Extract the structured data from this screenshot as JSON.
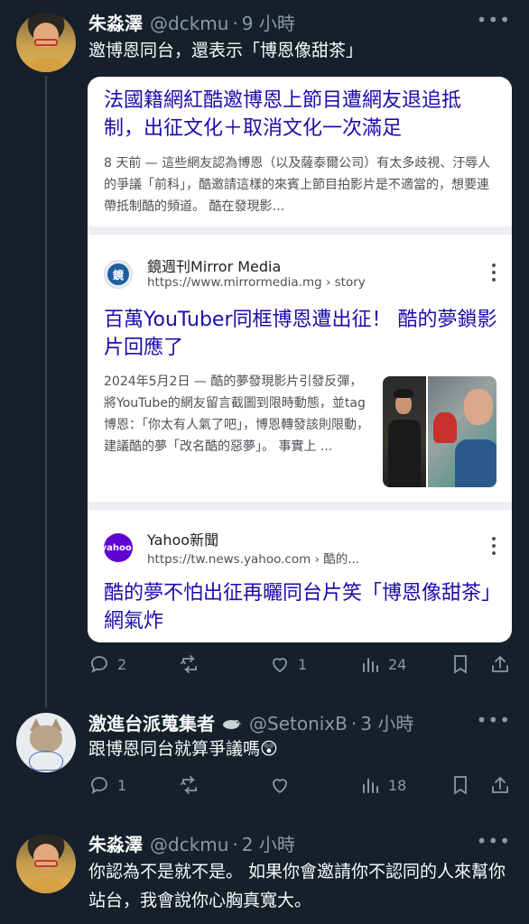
{
  "posts": [
    {
      "name": "朱淼澤",
      "handle": "@dckmu",
      "time": "9 小時",
      "text": "邀博恩同台，還表示「博恩像甜茶」",
      "actions": {
        "reply": "2",
        "retweet": "",
        "like": "1",
        "views": "24"
      }
    },
    {
      "name": "激進台派蒐集者",
      "handle": "@SetonixB",
      "time": "3 小時",
      "text": "跟博恩同台就算爭議嗎😲",
      "actions": {
        "reply": "1",
        "retweet": "",
        "like": "",
        "views": "18"
      }
    },
    {
      "name": "朱淼澤",
      "handle": "@dckmu",
      "time": "2 小時",
      "text": "你認為不是就不是。 如果你會邀請你不認同的人來幫你站台，我會說你心胸真寬大。"
    }
  ],
  "separator": "·",
  "more_label": "•••",
  "search_card": {
    "result1": {
      "title": "法國籍網紅酷邀博恩上節目遭網友退追抵制，出征文化＋取消文化一次滿足",
      "snippet": "8 天前 — 這些網友認為博恩（以及薩泰爾公司）有太多歧視、汙辱人的爭議「前科」，酷邀請這樣的來賓上節目拍影片是不適當的，想要連帶抵制酷的頻道。 酷在發現影…"
    },
    "result2": {
      "favicon": "鏡",
      "site": "鏡週刊Mirror Media",
      "url": "https://www.mirrormedia.mg › story",
      "title": "百萬YouTuber同框博恩遭出征！ 酷的夢鎖影片回應了",
      "snippet": "2024年5月2日 — 酷的夢發現影片引發反彈，將YouTube的網友留言截圖到限時動態，並tag博恩：「你太有人氣了吧」，博恩轉發該則限動，建議酷的夢「改名酷的惡夢」。 事實上 ..."
    },
    "result3": {
      "favicon": "yahoo!",
      "site": "Yahoo新聞",
      "url": "https://tw.news.yahoo.com › 酷的...",
      "title": "酷的夢不怕出征再曬同台片笑「博恩像甜茶」網氣炸"
    }
  },
  "colors": {
    "background": "#15202b",
    "link": "#1a0dab",
    "muted": "#8b98a5"
  }
}
